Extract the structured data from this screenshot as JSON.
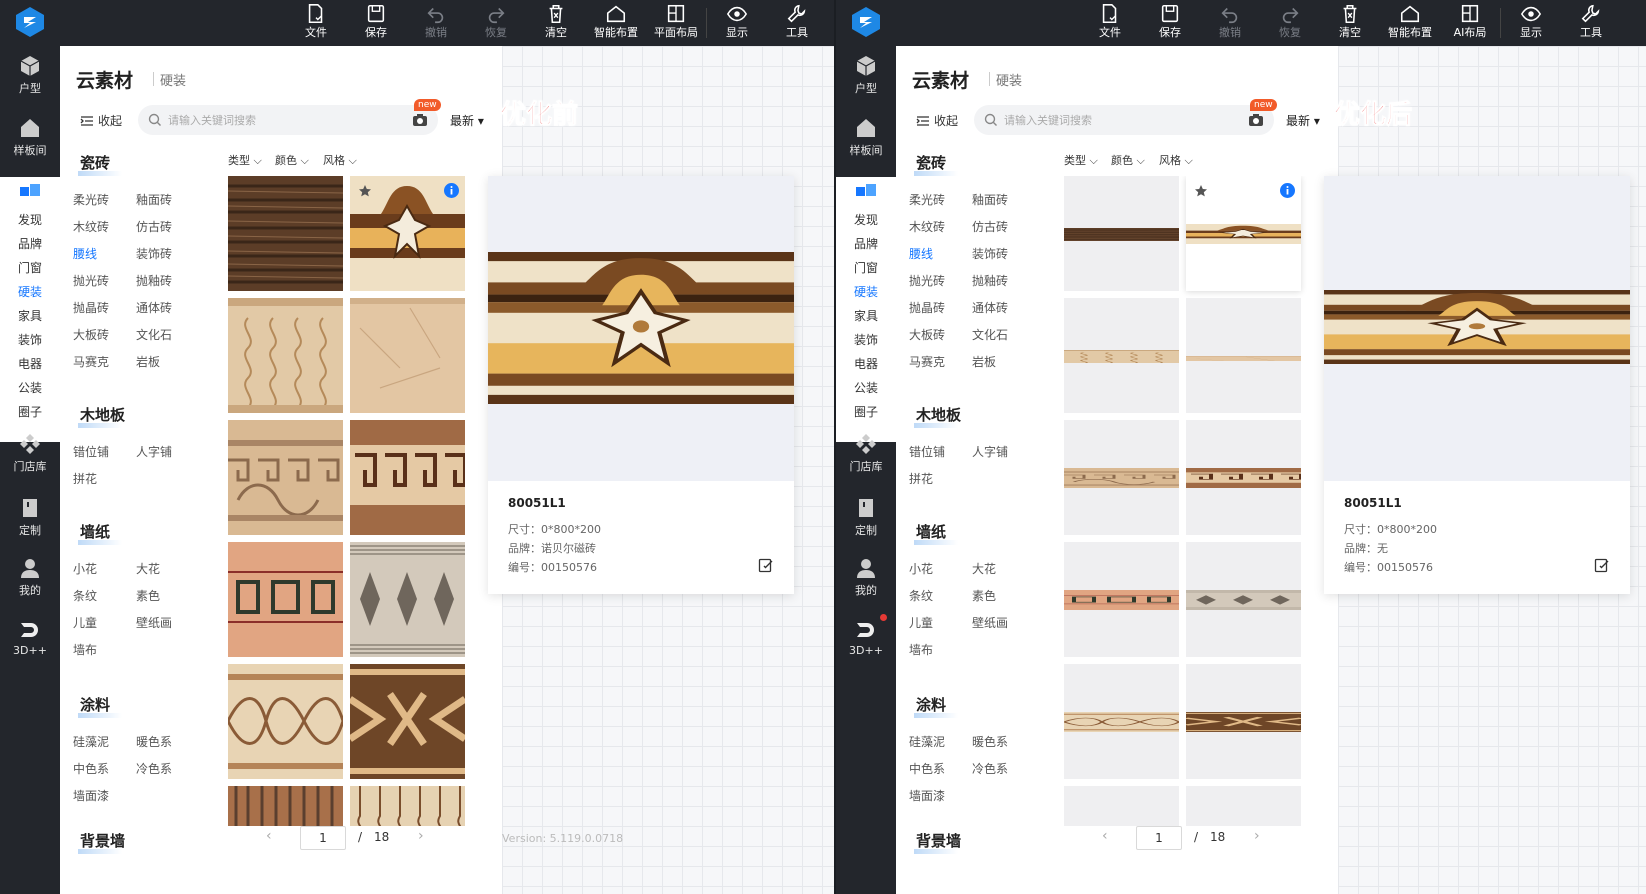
{
  "toolbar": {
    "left": [
      {
        "label": "文件",
        "icon": "file-icon",
        "enabled": true
      },
      {
        "label": "保存",
        "icon": "save-icon",
        "enabled": true
      },
      {
        "label": "撤销",
        "icon": "undo-icon",
        "enabled": false
      },
      {
        "label": "恢复",
        "icon": "redo-icon",
        "enabled": false
      },
      {
        "label": "清空",
        "icon": "clear-icon",
        "enabled": true
      },
      {
        "label": "智能布置",
        "icon": "home-icon",
        "enabled": true
      },
      {
        "label": "平面布局",
        "icon": "layout-icon",
        "enabled": true
      },
      {
        "label": "显示",
        "icon": "eye-icon",
        "enabled": true
      },
      {
        "label": "工具",
        "icon": "wrench-icon",
        "enabled": true
      }
    ],
    "right": [
      {
        "label": "文件",
        "icon": "file-icon",
        "enabled": true
      },
      {
        "label": "保存",
        "icon": "save-icon",
        "enabled": true
      },
      {
        "label": "撤销",
        "icon": "undo-icon",
        "enabled": false
      },
      {
        "label": "恢复",
        "icon": "redo-icon",
        "enabled": false
      },
      {
        "label": "清空",
        "icon": "clear-icon",
        "enabled": true
      },
      {
        "label": "智能布置",
        "icon": "home-icon",
        "enabled": true
      },
      {
        "label": "AI布局",
        "icon": "layout-icon",
        "enabled": true
      },
      {
        "label": "显示",
        "icon": "eye-icon",
        "enabled": true
      },
      {
        "label": "工具",
        "icon": "wrench-icon",
        "enabled": true
      }
    ]
  },
  "nav": {
    "huxing": "户型",
    "yangbanjian": "样板间",
    "sub": [
      "发现",
      "品牌",
      "门窗",
      "硬装",
      "家具",
      "装饰",
      "电器",
      "公装",
      "圈子"
    ],
    "active_sub": "硬装",
    "mendianku": "门店库",
    "dingzhi": "定制",
    "wode": "我的",
    "threed": "3D++"
  },
  "panel": {
    "title": "云素材",
    "subtitle": "硬装",
    "collapse": "收起",
    "search_placeholder": "请输入关键词搜索",
    "new_badge": "new",
    "sort": "最新 ▾",
    "filters": [
      "类型",
      "颜色",
      "风格"
    ],
    "categories": [
      {
        "name": "瓷砖",
        "items": [
          "柔光砖",
          "釉面砖",
          "木纹砖",
          "仿古砖",
          "腰线",
          "装饰砖",
          "抛光砖",
          "抛釉砖",
          "抛晶砖",
          "通体砖",
          "大板砖",
          "文化石",
          "马赛克",
          "岩板"
        ],
        "active": "腰线"
      },
      {
        "name": "木地板",
        "items": [
          "错位铺",
          "人字铺",
          "拼花"
        ]
      },
      {
        "name": "墙纸",
        "items": [
          "小花",
          "大花",
          "条纹",
          "素色",
          "儿童",
          "壁纸画",
          "墙布"
        ]
      },
      {
        "name": "涂料",
        "items": [
          "硅藻泥",
          "暖色系",
          "中色系",
          "冷色系",
          "墙面漆"
        ]
      },
      {
        "name": "背景墙",
        "items": []
      }
    ],
    "pager": {
      "current": "1",
      "separator": "/",
      "total": "18",
      "prev": "‹",
      "next": "›"
    }
  },
  "overlay": {
    "before": "优化前",
    "after": "优化后"
  },
  "version": "Version: 5.119.0.0718",
  "popup": {
    "before": {
      "code": "80051L1",
      "size": "尺寸：0*800*200",
      "brand": "品牌：诺贝尔磁砖",
      "number": "编号：00150576"
    },
    "after": {
      "code": "80051L1",
      "size": "尺寸：0*800*200",
      "brand": "品牌：无",
      "number": "编号：00150576"
    }
  },
  "colors": {
    "dark": "#23262c",
    "accent": "#1677ff",
    "title_red": "#e82a2a",
    "badge": "#f25b2a"
  }
}
